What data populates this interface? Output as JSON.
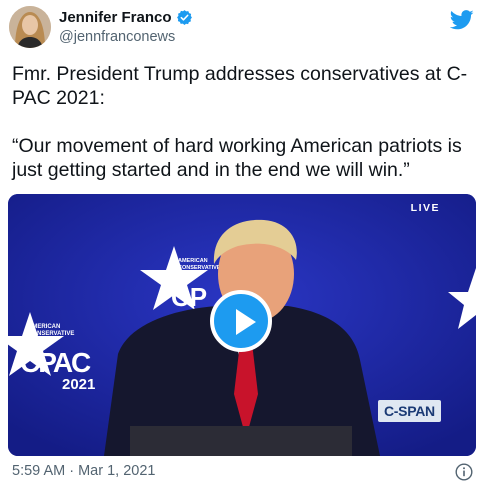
{
  "author": {
    "display_name": "Jennifer Franco",
    "handle": "@jennfranconews",
    "verified": true
  },
  "tweet": {
    "text_line1": "Fmr. President Trump addresses conservatives at C-PAC 2021:",
    "text_line2": "“Our movement of hard working American patriots is just getting started and in the end we will win.”"
  },
  "media": {
    "type": "video",
    "live_badge": "LIVE",
    "network_bug": "C-SPAN",
    "left_sign_line1": "AMERICAN",
    "left_sign_line2": "CONSERVATIVE",
    "left_sign_line3": "UNION",
    "left_sign_logo": "CPAC",
    "left_sign_year": "2021",
    "center_sign_line1": "AMERICAN",
    "center_sign_line2": "CONSERVATIVE",
    "center_sign_line3": "UNION",
    "center_sign_logo": "CP"
  },
  "footer": {
    "timestamp": "5:59 AM · Mar 1, 2021"
  },
  "icons": {
    "platform": "twitter-bird-icon",
    "info": "info-icon",
    "play": "play-icon"
  },
  "colors": {
    "twitter_blue": "#1d9bf0",
    "stage_blue": "#1d27a8",
    "secondary_text": "#536471"
  }
}
